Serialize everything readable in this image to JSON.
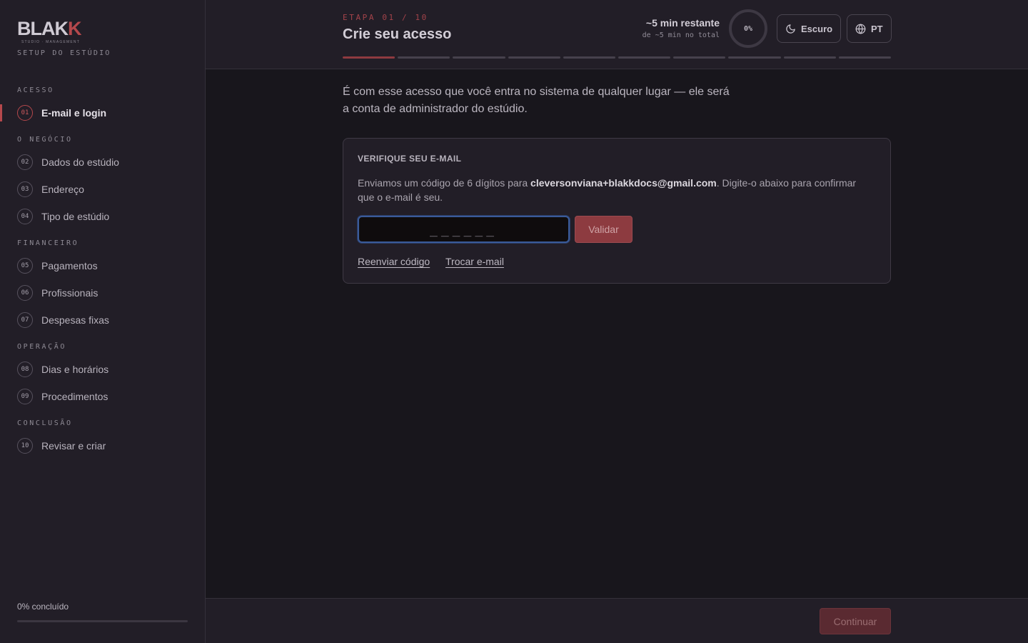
{
  "brand": {
    "logo_main": "BLAK",
    "logo_accent": "K",
    "logo_sub": "STUDIO · MANAGEMENT",
    "setup_label": "SETUP DO ESTÚDIO"
  },
  "sidebar": {
    "sections": [
      {
        "label": "ACESSO"
      },
      {
        "label": "O NEGÓCIO"
      },
      {
        "label": "FINANCEIRO"
      },
      {
        "label": "OPERAÇÃO"
      },
      {
        "label": "CONCLUSÃO"
      }
    ],
    "items": [
      {
        "num": "01",
        "label": "E-mail e login"
      },
      {
        "num": "02",
        "label": "Dados do estúdio"
      },
      {
        "num": "03",
        "label": "Endereço"
      },
      {
        "num": "04",
        "label": "Tipo de estúdio"
      },
      {
        "num": "05",
        "label": "Pagamentos"
      },
      {
        "num": "06",
        "label": "Profissionais"
      },
      {
        "num": "07",
        "label": "Despesas fixas"
      },
      {
        "num": "08",
        "label": "Dias e horários"
      },
      {
        "num": "09",
        "label": "Procedimentos"
      },
      {
        "num": "10",
        "label": "Revisar e criar"
      }
    ],
    "active_index": 0,
    "progress_text": "0% concluído",
    "progress_fraction": 0
  },
  "header": {
    "step_label": "ETAPA 01 / 10",
    "title": "Crie seu acesso",
    "time_remaining": "~5 min restante",
    "time_total": "de ~5 min no total",
    "percent": "0%",
    "theme_label": "Escuro",
    "lang_label": "PT",
    "segments_total": 10,
    "segments_done": 1
  },
  "main": {
    "intro_line1": "É com esse acesso que você entra no sistema de qualquer lugar — ele será",
    "intro_line2": "a conta de administrador do estúdio.",
    "card": {
      "title": "VERIFIQUE SEU E-MAIL",
      "text_before": "Enviamos um código de 6 dígitos para ",
      "email": "cleversonviana+blakkdocs@gmail.com",
      "text_after": ". Digite-o abaixo para confirmar que o e-mail é seu.",
      "code_placeholder": "______",
      "validate_label": "Validar",
      "resend_label": "Reenviar código",
      "change_email_label": "Trocar e-mail"
    }
  },
  "footer": {
    "continue_label": "Continuar"
  },
  "colors": {
    "accent": "#b5484c",
    "background": "#18161c",
    "panel": "#221e27"
  }
}
